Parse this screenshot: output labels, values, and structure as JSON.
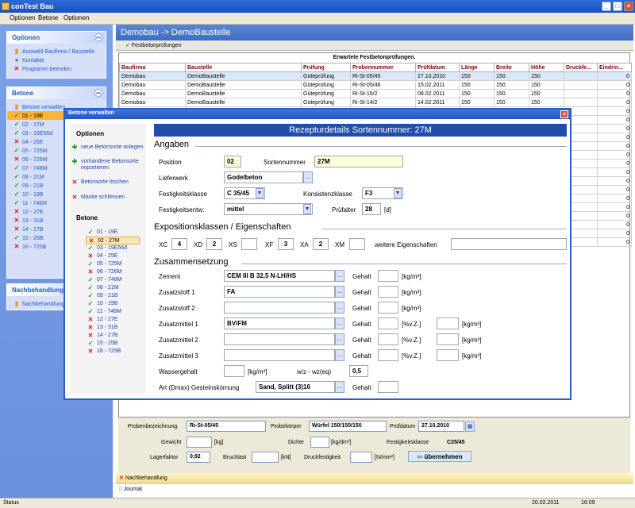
{
  "window": {
    "title": "conTest Bau"
  },
  "menu": [
    "Optionen",
    "Betone",
    "Optionen"
  ],
  "left": {
    "optionen_title": "Optionen",
    "optionen_items": [
      "Auswahl Baufirma / Baustelle",
      "Kontakte",
      "Programm beenden"
    ],
    "betone_title": "Betone",
    "betone_items": [
      {
        "label": "Betone verwalten",
        "status": "none"
      },
      {
        "label": "01 - 19E",
        "status": "ok"
      },
      {
        "label": "02 - 27M",
        "status": "ok"
      },
      {
        "label": "03 - 19E56d",
        "status": "ok"
      },
      {
        "label": "04 - 25E",
        "status": "bad"
      },
      {
        "label": "05 - 725M",
        "status": "ok"
      },
      {
        "label": "06 - 726M",
        "status": "bad"
      },
      {
        "label": "07 - 748M",
        "status": "ok"
      },
      {
        "label": "08 - 21M",
        "status": "ok"
      },
      {
        "label": "09 - 21B",
        "status": "ok"
      },
      {
        "label": "10 - 19B",
        "status": "ok"
      },
      {
        "label": "11 - 746M",
        "status": "ok"
      },
      {
        "label": "12 - 27E",
        "status": "bad"
      },
      {
        "label": "13 - 31B",
        "status": "bad"
      },
      {
        "label": "14 - 27B",
        "status": "bad"
      },
      {
        "label": "15 - 25B",
        "status": "ok"
      },
      {
        "label": "16 - 725B",
        "status": "bad"
      }
    ],
    "nach_title": "Nachbehandlung",
    "nach_items": [
      "Nachbehandlung"
    ]
  },
  "main": {
    "title": "Demobau -> DemoBaustelle",
    "tab": "Festbetonprüfungen",
    "grid_caption": "Erwartete Festbetonprüfungen.",
    "columns": [
      "Baufirma",
      "Baustelle",
      "Prüfung",
      "Probennummer",
      "Prüfdatum",
      "Länge",
      "Breite",
      "Höhe",
      "Druckfe...",
      "Eindrin..."
    ],
    "rows": [
      [
        "Demobau",
        "DemoBaustelle",
        "Güteprüfung",
        "Ri-St-05/45",
        "27.10.2010",
        "150",
        "150",
        "150",
        "",
        "0"
      ],
      [
        "Demobau",
        "DemoBaustelle",
        "Güteprüfung",
        "Ri-St-05/46",
        "15.02.2011",
        "150",
        "150",
        "150",
        "",
        "0"
      ],
      [
        "Demobau",
        "DemoBaustelle",
        "Güteprüfung",
        "Ri-St-16/2",
        "08.02.2011",
        "150",
        "150",
        "150",
        "",
        "0"
      ],
      [
        "Demobau",
        "DemoBaustelle",
        "Güteprüfung",
        "Ri-St-14/2",
        "14.02.2011",
        "150",
        "150",
        "150",
        "",
        "0"
      ],
      [
        "",
        "",
        "",
        "",
        "",
        "",
        "",
        "",
        "",
        "0"
      ],
      [
        "",
        "",
        "",
        "",
        "",
        "",
        "",
        "",
        "",
        "0"
      ],
      [
        "",
        "",
        "",
        "",
        "",
        "",
        "",
        "",
        "",
        "0"
      ],
      [
        "",
        "",
        "",
        "",
        "",
        "",
        "",
        "",
        "",
        "0"
      ],
      [
        "",
        "",
        "",
        "",
        "",
        "",
        "",
        "",
        "",
        "0"
      ],
      [
        "",
        "",
        "",
        "",
        "",
        "",
        "",
        "",
        "",
        "0"
      ],
      [
        "",
        "",
        "",
        "",
        "",
        "",
        "",
        "",
        "",
        "0"
      ],
      [
        "",
        "",
        "",
        "",
        "",
        "",
        "",
        "",
        "",
        "0"
      ],
      [
        "",
        "",
        "",
        "",
        "",
        "",
        "",
        "",
        "",
        "0"
      ],
      [
        "",
        "",
        "",
        "",
        "",
        "",
        "",
        "",
        "",
        "0"
      ],
      [
        "",
        "",
        "",
        "",
        "",
        "",
        "",
        "",
        "",
        "0"
      ],
      [
        "",
        "",
        "",
        "",
        "",
        "",
        "",
        "",
        "",
        "0"
      ],
      [
        "",
        "",
        "",
        "",
        "",
        "",
        "",
        "",
        "",
        "0"
      ],
      [
        "",
        "",
        "",
        "",
        "",
        "",
        "",
        "",
        "",
        "0"
      ],
      [
        "",
        "",
        "",
        "",
        "",
        "",
        "",
        "",
        "",
        "0"
      ],
      [
        "",
        "",
        "",
        "",
        "",
        "",
        "",
        "",
        "",
        "0"
      ]
    ]
  },
  "bottom": {
    "probenbezeichnung_label": "Probenbezeichnung",
    "probenbezeichnung": "Ri-St-05/45",
    "probekoerper_label": "Probekörper",
    "probekoerper": "Würfel 150/150/150",
    "pruefdatum_label": "Prüfdatum",
    "pruefdatum": "27.10.2010",
    "gewicht_label": "Gewicht",
    "gewicht_unit": "[kg]",
    "dichte_label": "Dichte",
    "dichte_unit": "[kg/dm³]",
    "festigkeitsklasse_label": "Festigkeitsklasse",
    "festigkeitsklasse": "C35/45",
    "lagerfaktor_label": "Lagerfaktor",
    "lagerfaktor": "0,92",
    "bruchlast_label": "Bruchlast",
    "bruchlast_unit": "[kN]",
    "druckfestigkeit_label": "Druckfestigkeit",
    "druckfestigkeit_unit": "[N/mm²]",
    "uebernehmen": "übernehmen"
  },
  "nachbehandlung": "Nachbehandlung",
  "journal": "Journal",
  "status": {
    "text": "Status",
    "date": "20.02.2011",
    "time": "16:09"
  },
  "dialog": {
    "title": "Betone verwalten",
    "optionen_title": "Optionen",
    "options": [
      "neue Betonsorte anlegen",
      "vorhandene Betonsorte importieren",
      "Betonsorte löschen",
      "Maske schliessen"
    ],
    "betone_title": "Betone",
    "betone": [
      {
        "label": "01 - 19E",
        "status": "ok"
      },
      {
        "label": "02 - 27M",
        "status": "bad"
      },
      {
        "label": "03 - 19E56d",
        "status": "ok"
      },
      {
        "label": "04 - 25E",
        "status": "bad"
      },
      {
        "label": "05 - 725M",
        "status": "ok"
      },
      {
        "label": "06 - 726M",
        "status": "bad"
      },
      {
        "label": "07 - 748M",
        "status": "ok"
      },
      {
        "label": "08 - 21M",
        "status": "ok"
      },
      {
        "label": "09 - 21B",
        "status": "ok"
      },
      {
        "label": "10 - 19B",
        "status": "ok"
      },
      {
        "label": "11 - 746M",
        "status": "ok"
      },
      {
        "label": "12 - 27E",
        "status": "bad"
      },
      {
        "label": "13 - 31B",
        "status": "bad"
      },
      {
        "label": "14 - 27B",
        "status": "bad"
      },
      {
        "label": "15 - 25B",
        "status": "ok"
      },
      {
        "label": "16 - 725B",
        "status": "bad"
      }
    ],
    "header": "Rezepturdetails Sortennummer: 27M",
    "angaben": {
      "title": "Angaben",
      "position_label": "Position",
      "position": "02",
      "sortennummer_label": "Sortennummer",
      "sortennummer": "27M",
      "lieferwerk_label": "Lieferwerk",
      "lieferwerk": "Godelbeton",
      "festigkeitsklasse_label": "Festigkeitsklasse",
      "festigkeitsklasse": "C 35/45",
      "konsistenzklasse_label": "Konsistenzklasse",
      "konsistenzklasse": "F3",
      "festigkeitsentw_label": "Festigkeitsentw:",
      "festigkeitsentw": "mittel",
      "pruefalter_label": "Prüfalter",
      "pruefalter": "28",
      "pruefalter_unit": "[d]"
    },
    "expo": {
      "title": "Expositionsklassen / Eigenschaften",
      "xc_label": "XC",
      "xc": "4",
      "xd_label": "XD",
      "xd": "2",
      "xs_label": "XS",
      "xs": "",
      "xf_label": "XF",
      "xf": "3",
      "xa_label": "XA",
      "xa": "2",
      "xm_label": "XM",
      "xm": "",
      "weitere_label": "weitere Eigenschaften",
      "weitere": ""
    },
    "zus": {
      "title": "Zusammensetzung",
      "gehalt_label": "Gehalt",
      "rows": [
        {
          "label": "Zement",
          "value": "CEM III B 32,5 N-LH/HS",
          "unit": "[kg/m³]"
        },
        {
          "label": "Zusatzstoff 1",
          "value": "FA",
          "unit": "[kg/m³]"
        },
        {
          "label": "Zusatzstoff 2",
          "value": "",
          "unit": "[kg/m³]"
        },
        {
          "label": "Zusatzmittel 1",
          "value": "BV/FM",
          "unit": "[%v.Z.]",
          "unit2": "[kg/m³]"
        },
        {
          "label": "Zusatzmittel 2",
          "value": "",
          "unit": "[%v.Z.]",
          "unit2": "[kg/m³]"
        },
        {
          "label": "Zusatzmittel 3",
          "value": "",
          "unit": "[%v.Z.]",
          "unit2": "[kg/m³]"
        }
      ],
      "wassergehalt_label": "Wassergehalt",
      "wassergehalt_unit": "[kg/m³]",
      "wz_label": "w/z - wz(eq)",
      "wz": "0,5",
      "art_label": "Art (Dmax) Gesteinskörnung",
      "art": "Sand, Splitt (3)16"
    }
  }
}
